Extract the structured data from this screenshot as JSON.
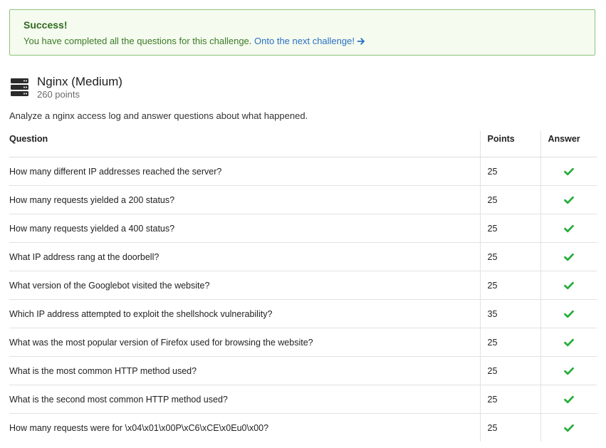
{
  "alert": {
    "title": "Success!",
    "message": "You have completed all the questions for this challenge.",
    "link_label": "Onto the next challenge!",
    "link_icon": "arrow-right-icon"
  },
  "challenge": {
    "icon": "server-icon",
    "title": "Nginx (Medium)",
    "points": "260 points",
    "description": "Analyze a nginx access log and answer questions about what happened."
  },
  "table": {
    "headers": {
      "question": "Question",
      "points": "Points",
      "answer": "Answer"
    },
    "rows": [
      {
        "question": "How many different IP addresses reached the server?",
        "points": "25",
        "answered": true
      },
      {
        "question": "How many requests yielded a 200 status?",
        "points": "25",
        "answered": true
      },
      {
        "question": "How many requests yielded a 400 status?",
        "points": "25",
        "answered": true
      },
      {
        "question": "What IP address rang at the doorbell?",
        "points": "25",
        "answered": true
      },
      {
        "question": "What version of the Googlebot visited the website?",
        "points": "25",
        "answered": true
      },
      {
        "question": "Which IP address attempted to exploit the shellshock vulnerability?",
        "points": "35",
        "answered": true
      },
      {
        "question": "What was the most popular version of Firefox used for browsing the website?",
        "points": "25",
        "answered": true
      },
      {
        "question": "What is the most common HTTP method used?",
        "points": "25",
        "answered": true
      },
      {
        "question": "What is the second most common HTTP method used?",
        "points": "25",
        "answered": true
      },
      {
        "question": "How many requests were for \\x04\\x01\\x00P\\xC6\\xCE\\x0Eu0\\x00?",
        "points": "25",
        "answered": true
      }
    ]
  },
  "colors": {
    "success_border": "#8fc27d",
    "success_bg": "#f5fbef",
    "success_title": "#2f6a1e",
    "link": "#2a6fc4",
    "check": "#27ae3c"
  }
}
